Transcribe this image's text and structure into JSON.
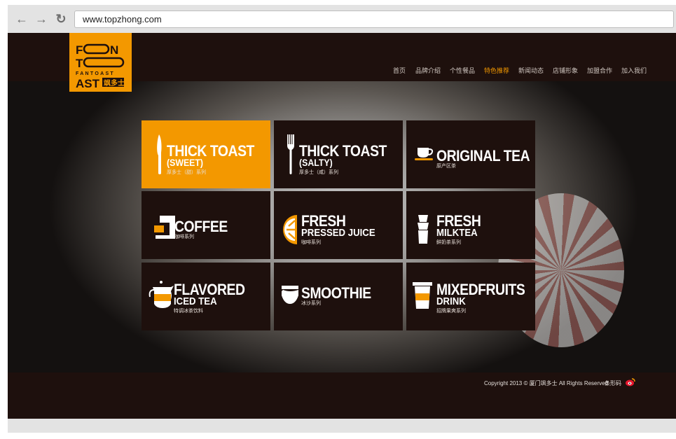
{
  "browser": {
    "url": "www.topzhong.com",
    "back_icon": "arrow-left-icon",
    "forward_icon": "arrow-right-icon",
    "reload_icon": "reload-icon"
  },
  "logo": {
    "text": "FANTOAST 飒多士"
  },
  "nav": {
    "items": [
      {
        "label": "首页"
      },
      {
        "label": "品牌介绍"
      },
      {
        "label": "个性餐品"
      },
      {
        "label": "特色推荐",
        "active": true
      },
      {
        "label": "新闻动态"
      },
      {
        "label": "店铺形象"
      },
      {
        "label": "加盟合作"
      },
      {
        "label": "加入我们"
      }
    ],
    "active_color": "#f39800"
  },
  "tiles": [
    {
      "title": "THICK TOAST",
      "subtitle": "(SWEET)",
      "cn": "厚多士（甜）系列",
      "icon": "knife-icon",
      "active": true
    },
    {
      "title": "THICK TOAST",
      "subtitle": "(SALTY)",
      "cn": "厚多士（咸）系列",
      "icon": "fork-icon"
    },
    {
      "title": "ORIGINAL TEA",
      "subtitle": "",
      "cn": "原产区茶",
      "icon": "teacup-icon"
    },
    {
      "title": "COFFEE",
      "subtitle": "",
      "cn": "咖啡系列",
      "icon": "coffee-machine-icon"
    },
    {
      "title": "FRESH",
      "subtitle": "PRESSED JUICE",
      "cn": "咖啡系列",
      "icon": "orange-slice-icon"
    },
    {
      "title": "FRESH",
      "subtitle": "MILKTEA",
      "cn": "鲜奶茶系列",
      "icon": "stacked-cups-icon"
    },
    {
      "title": "FLAVORED",
      "subtitle": "ICED TEA",
      "cn": "特调冰茶饮料",
      "icon": "teapot-icon"
    },
    {
      "title": "SMOOTHIE",
      "subtitle": "",
      "cn": "冰沙系列",
      "icon": "smoothie-bowl-icon"
    },
    {
      "title": "MIXEDFRUITS",
      "subtitle": "DRINK",
      "cn": "招牌果爽系列",
      "icon": "takeaway-cup-icon"
    }
  ],
  "footer": {
    "copyright": "Copyright 2013 © 厦门飒多士 All Rights Reserved",
    "barcode": "条形码",
    "weibo_icon": "weibo-icon"
  },
  "colors": {
    "brand": "#f39800",
    "dark": "#1e100d"
  }
}
